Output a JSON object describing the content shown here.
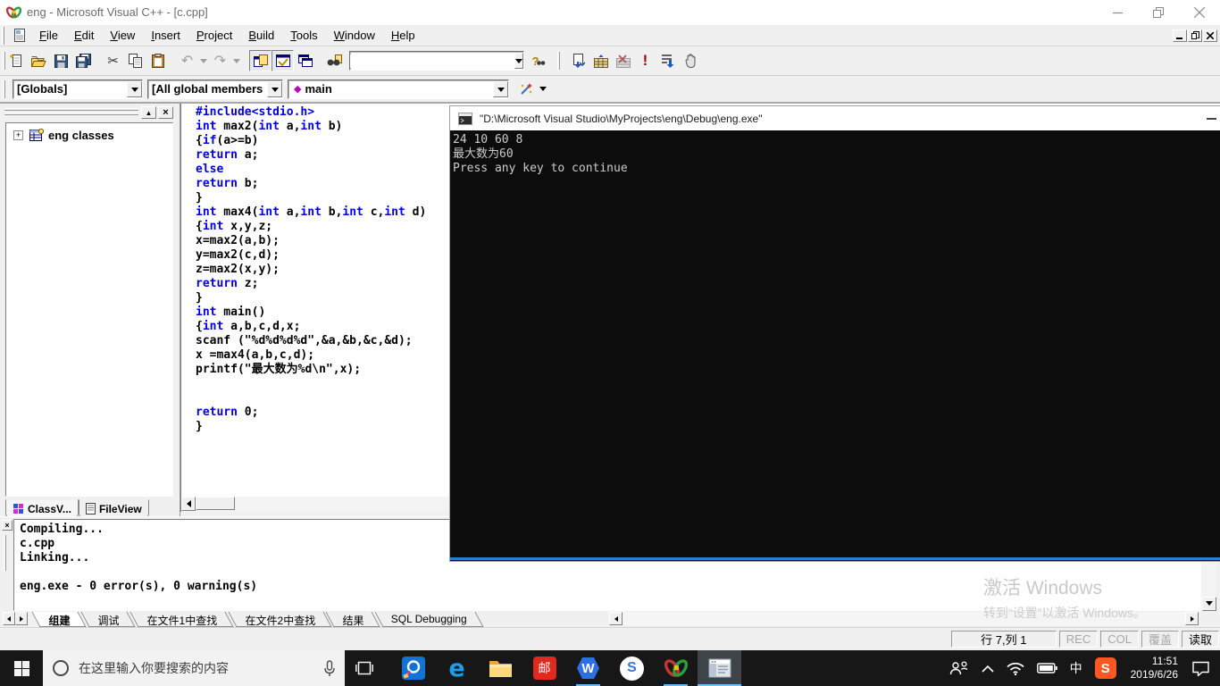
{
  "titlebar": {
    "title": "eng - Microsoft Visual C++ - [c.cpp]"
  },
  "menu": {
    "items": [
      "File",
      "Edit",
      "View",
      "Insert",
      "Project",
      "Build",
      "Tools",
      "Window",
      "Help"
    ]
  },
  "toolbar": {
    "find_value": ""
  },
  "glyphs": {
    "cut": "✂",
    "undo": "↶",
    "redo": "↷",
    "execute": "!",
    "query_help": "?",
    "function_diamond": "◆",
    "tree_expand": "+",
    "close_x": "×",
    "panel_up": "▲"
  },
  "wizardbar": {
    "class_value": "[Globals]",
    "members_value": "[All global members",
    "function_value": "main"
  },
  "workspace": {
    "root_label": "eng classes",
    "tabs": [
      "ClassV...",
      "FileView"
    ]
  },
  "code": {
    "keyword_color": "#0000dd",
    "lines": [
      [
        [
          "k",
          "#include<stdio.h>"
        ]
      ],
      [
        [
          "k",
          "int"
        ],
        [
          "p",
          " max2("
        ],
        [
          "k",
          "int"
        ],
        [
          "p",
          " a,"
        ],
        [
          "k",
          "int"
        ],
        [
          "p",
          " b)"
        ]
      ],
      [
        [
          "p",
          "{"
        ],
        [
          "k",
          "if"
        ],
        [
          "p",
          "(a>=b)"
        ]
      ],
      [
        [
          "k",
          "return"
        ],
        [
          "p",
          " a;"
        ]
      ],
      [
        [
          "k",
          "else"
        ]
      ],
      [
        [
          "k",
          "return"
        ],
        [
          "p",
          " b;"
        ]
      ],
      [
        [
          "p",
          "}"
        ]
      ],
      [
        [
          "k",
          "int"
        ],
        [
          "p",
          " max4("
        ],
        [
          "k",
          "int"
        ],
        [
          "p",
          " a,"
        ],
        [
          "k",
          "int"
        ],
        [
          "p",
          " b,"
        ],
        [
          "k",
          "int"
        ],
        [
          "p",
          " c,"
        ],
        [
          "k",
          "int"
        ],
        [
          "p",
          " d)"
        ]
      ],
      [
        [
          "p",
          "{"
        ],
        [
          "k",
          "int"
        ],
        [
          "p",
          " x,y,z;"
        ]
      ],
      [
        [
          "p",
          "x=max2(a,b);"
        ]
      ],
      [
        [
          "p",
          "y=max2(c,d);"
        ]
      ],
      [
        [
          "p",
          "z=max2(x,y);"
        ]
      ],
      [
        [
          "k",
          "return"
        ],
        [
          "p",
          " z;"
        ]
      ],
      [
        [
          "p",
          "}"
        ]
      ],
      [
        [
          "k",
          "int"
        ],
        [
          "p",
          " main()"
        ]
      ],
      [
        [
          "p",
          "{"
        ],
        [
          "k",
          "int"
        ],
        [
          "p",
          " a,b,c,d,x;"
        ]
      ],
      [
        [
          "p",
          "scanf (\"%d%d%d%d\",&a,&b,&c,&d);"
        ]
      ],
      [
        [
          "p",
          "x =max4(a,b,c,d);"
        ]
      ],
      [
        [
          "p",
          "printf(\"最大数为%d\\n\",x);"
        ]
      ],
      [],
      [],
      [
        [
          "k",
          "return"
        ],
        [
          "p",
          " 0;"
        ]
      ],
      [
        [
          "p",
          "}"
        ]
      ]
    ]
  },
  "outputpanel": {
    "lines": [
      "Compiling...",
      "c.cpp",
      "Linking...",
      "",
      "eng.exe - 0 error(s), 0 warning(s)"
    ],
    "tabs": [
      "组建",
      "调试",
      "在文件1中查找",
      "在文件2中查找",
      "结果",
      "SQL Debugging"
    ],
    "active_tab": "组建"
  },
  "statusbar": {
    "position": "行 7,列 1",
    "rec": "REC",
    "col": "COL",
    "overwrite": "覆盖",
    "read": "读取"
  },
  "console": {
    "title": "\"D:\\Microsoft Visual Studio\\MyProjects\\eng\\Debug\\eng.exe\"",
    "lines": [
      "24 10 60 8",
      "最大数为60",
      "Press any key to continue"
    ]
  },
  "watermark": {
    "title": "激活 Windows",
    "subtitle": "转到“设置”以激活 Windows。"
  },
  "taskbar": {
    "search_placeholder": "在这里输入你要搜索的内容",
    "input_indicator": "中",
    "mail_logo": "邮",
    "wps_logo": "W",
    "sogou_logo": "S",
    "edge_logo": "e",
    "sogou_ime_logo": "S",
    "clock": {
      "time": "11:51",
      "date": "2019/6/26"
    }
  }
}
